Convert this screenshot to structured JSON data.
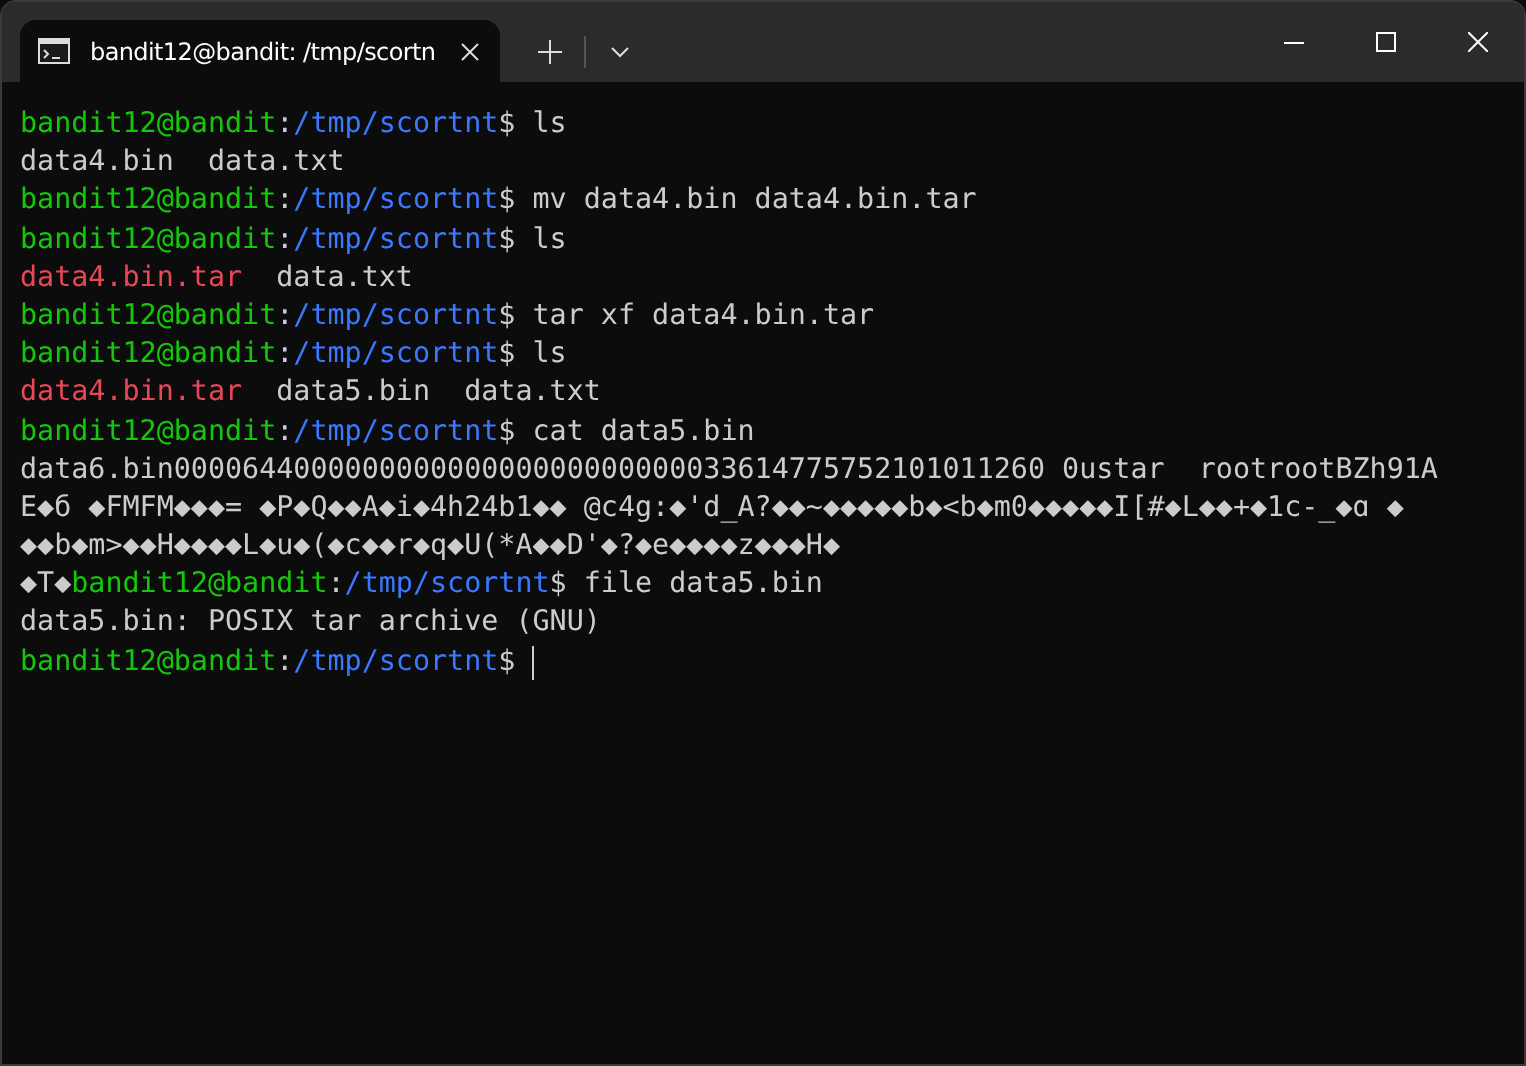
{
  "tab": {
    "title": "bandit12@bandit: /tmp/scortn",
    "selected": true
  },
  "terminal": {
    "lines": [
      [
        {
          "kind": "user",
          "text": "bandit12@bandit"
        },
        {
          "kind": "plain",
          "text": ":"
        },
        {
          "kind": "path",
          "text": "/tmp/scortnt"
        },
        {
          "kind": "plain",
          "text": "$ ls"
        }
      ],
      [
        {
          "kind": "plain",
          "text": "data4.bin  data.txt"
        }
      ],
      [
        {
          "kind": "user",
          "text": "bandit12@bandit"
        },
        {
          "kind": "plain",
          "text": ":"
        },
        {
          "kind": "path",
          "text": "/tmp/scortnt"
        },
        {
          "kind": "plain",
          "text": "$ mv data4.bin data4.bin.tar"
        }
      ],
      [
        {
          "kind": "user",
          "text": "bandit12@bandit"
        },
        {
          "kind": "plain",
          "text": ":"
        },
        {
          "kind": "path",
          "text": "/tmp/scortnt"
        },
        {
          "kind": "plain",
          "text": "$ ls"
        }
      ],
      [
        {
          "kind": "archive",
          "text": "data4.bin.tar"
        },
        {
          "kind": "plain",
          "text": "  data.txt"
        }
      ],
      [
        {
          "kind": "user",
          "text": "bandit12@bandit"
        },
        {
          "kind": "plain",
          "text": ":"
        },
        {
          "kind": "path",
          "text": "/tmp/scortnt"
        },
        {
          "kind": "plain",
          "text": "$ tar xf data4.bin.tar"
        }
      ],
      [
        {
          "kind": "user",
          "text": "bandit12@bandit"
        },
        {
          "kind": "plain",
          "text": ":"
        },
        {
          "kind": "path",
          "text": "/tmp/scortnt"
        },
        {
          "kind": "plain",
          "text": "$ ls"
        }
      ],
      [
        {
          "kind": "archive",
          "text": "data4.bin.tar"
        },
        {
          "kind": "plain",
          "text": "  data5.bin  data.txt"
        }
      ],
      [
        {
          "kind": "user",
          "text": "bandit12@bandit"
        },
        {
          "kind": "plain",
          "text": ":"
        },
        {
          "kind": "path",
          "text": "/tmp/scortnt"
        },
        {
          "kind": "plain",
          "text": "$ cat data5.bin"
        }
      ],
      [
        {
          "kind": "plain",
          "text": "data6.bin000064400000000000000000000000033614775752101011260 0ustar  rootrootBZh91A"
        }
      ],
      [
        {
          "kind": "plain",
          "text": "E◆б ◆FMFM◆◆◆= ◆P◆Q◆◆A◆i◆4h24b1◆◆ @c4g:◆'d_A?◆◆~◆◆◆◆◆b◆<b◆m0◆◆◆◆◆I[#◆L◆◆+◆1c-_◆ɑ ◆"
        }
      ],
      [
        {
          "kind": "plain",
          "text": "◆◆b◆m>◆◆H◆◆◆◆L◆u◆(◆c◆◆r◆q◆U(*A◆◆D'◆?◆e◆◆◆◆z◆◆◆H◆"
        }
      ],
      [
        {
          "kind": "plain",
          "text": "◆T◆"
        },
        {
          "kind": "user",
          "text": "bandit12@bandit"
        },
        {
          "kind": "plain",
          "text": ":"
        },
        {
          "kind": "path",
          "text": "/tmp/scortnt"
        },
        {
          "kind": "plain",
          "text": "$ file data5.bin"
        }
      ],
      [
        {
          "kind": "plain",
          "text": "data5.bin: POSIX tar archive (GNU)"
        }
      ],
      [
        {
          "kind": "user",
          "text": "bandit12@bandit"
        },
        {
          "kind": "plain",
          "text": ":"
        },
        {
          "kind": "path",
          "text": "/tmp/scortnt"
        },
        {
          "kind": "plain",
          "text": "$ "
        },
        {
          "kind": "cursor"
        }
      ]
    ]
  }
}
